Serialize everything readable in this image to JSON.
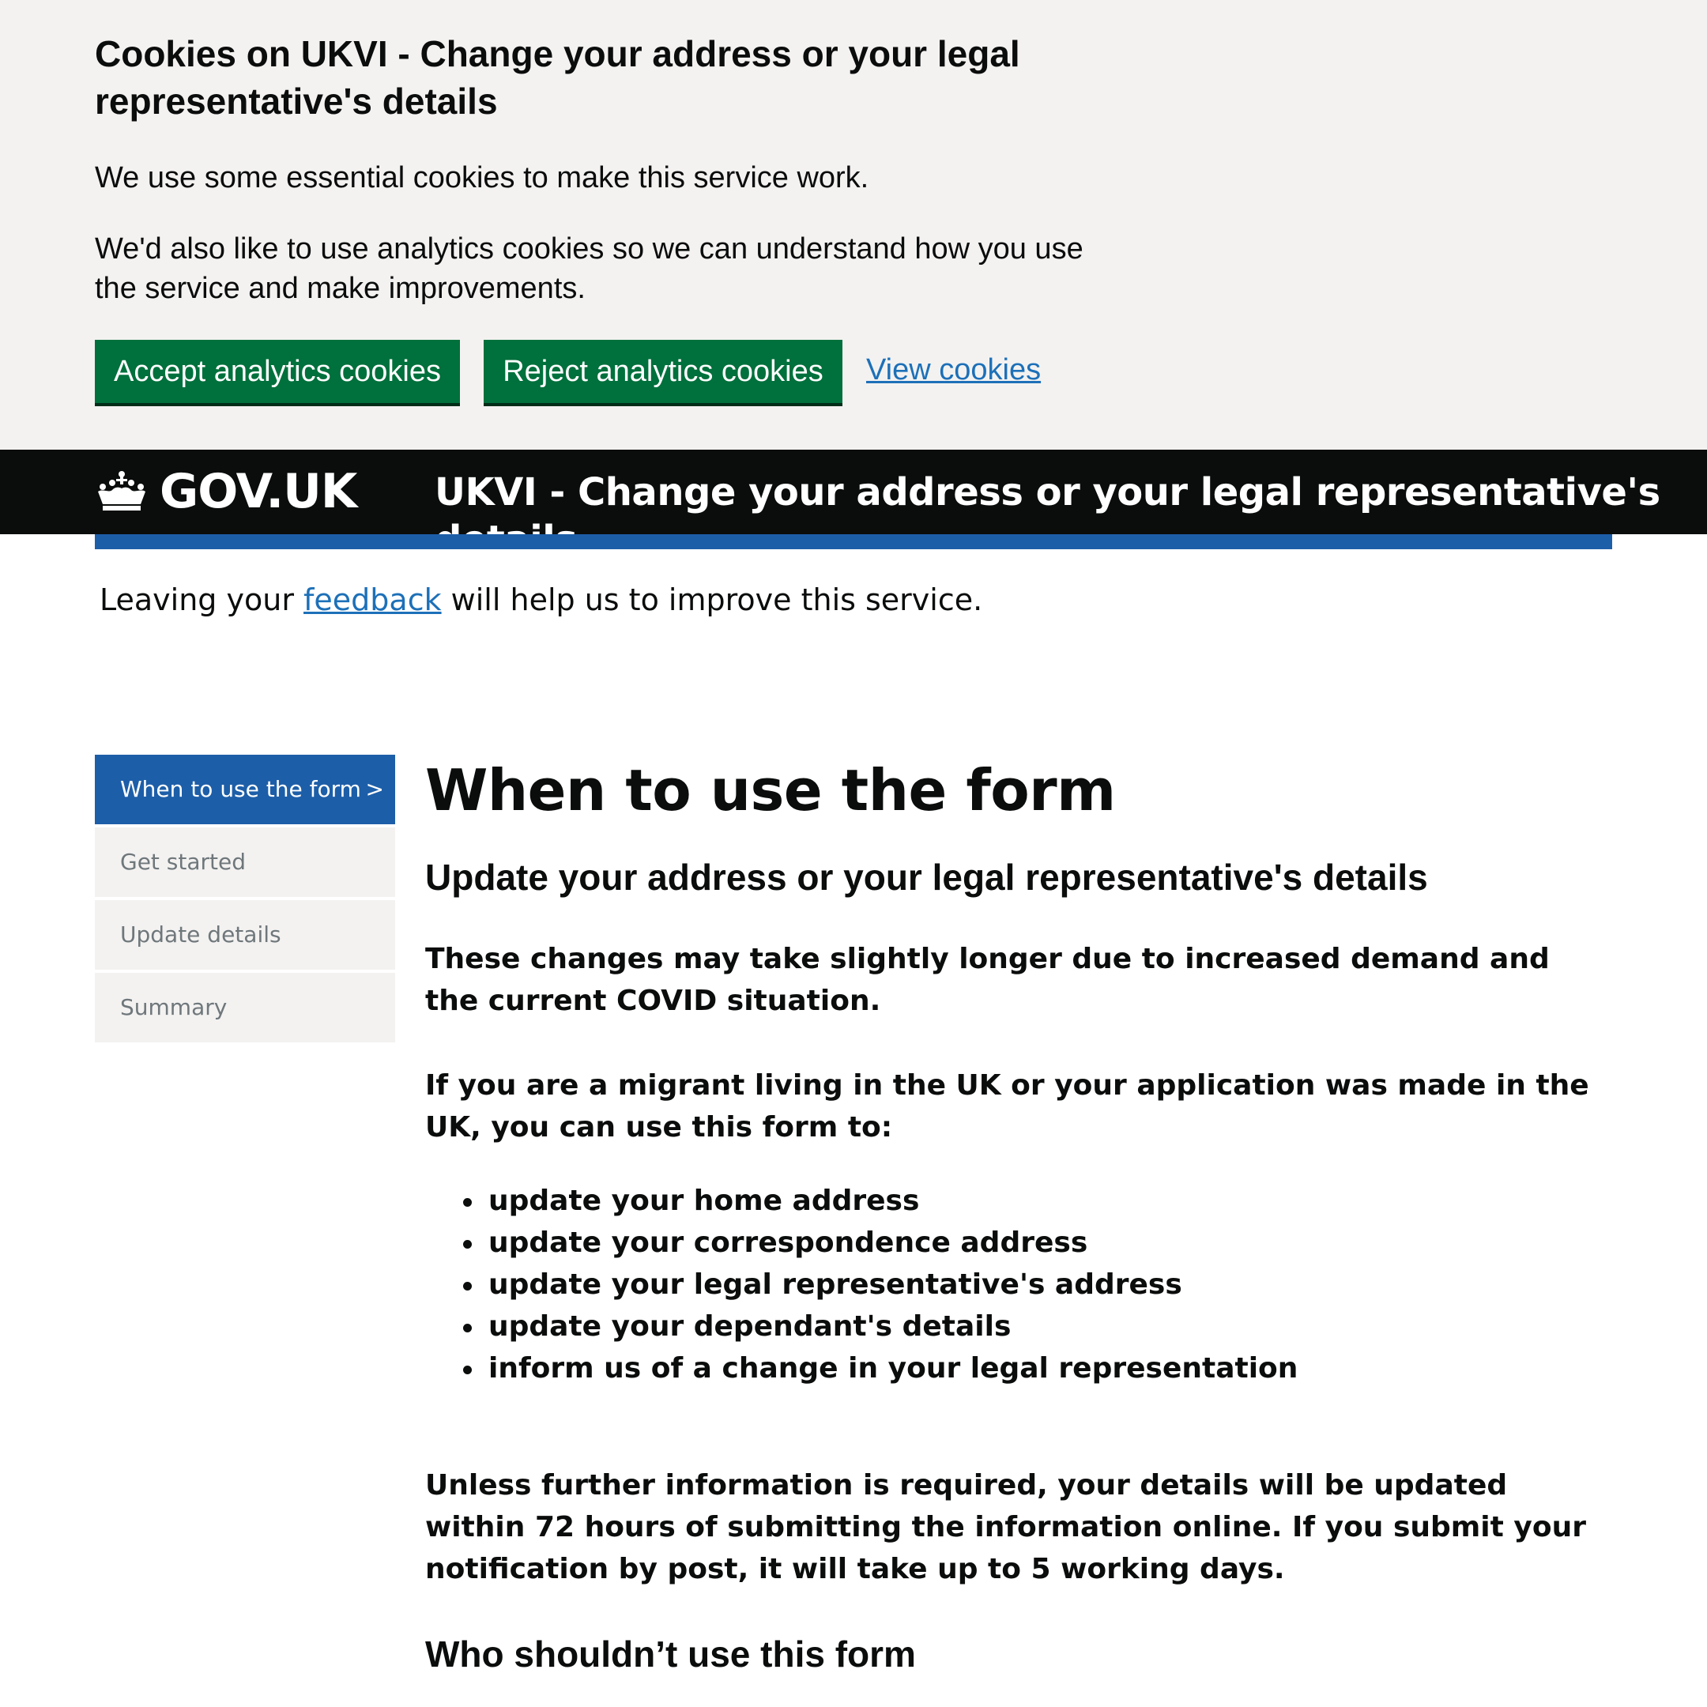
{
  "cookie_banner": {
    "title": "Cookies on UKVI - Change your address or your legal representative's details",
    "paragraph_1": "We use some essential cookies to make this service work.",
    "paragraph_2": "We'd also like to use analytics cookies so we can understand how you use the service and make improvements.",
    "accept_label": "Accept analytics cookies",
    "reject_label": "Reject analytics cookies",
    "view_link": "View cookies",
    "button_color": "#00703c"
  },
  "header": {
    "logo_text": "GOV.UK",
    "logo_icon": "crown-icon",
    "service_name": "UKVI - Change your address or your legal representative's details",
    "background": "#0b0c0c",
    "accent_bar": "#1d5ea8"
  },
  "feedback": {
    "before": "Leaving your ",
    "link": "feedback",
    "after": " will help us to improve this service."
  },
  "sidenav": {
    "items": [
      {
        "label": "When to use the form",
        "arrow": ">",
        "active": true
      },
      {
        "label": "Get started",
        "active": false
      },
      {
        "label": "Update details",
        "active": false
      },
      {
        "label": "Summary",
        "active": false
      }
    ]
  },
  "main": {
    "heading": "When to use the form",
    "subheading": "Update your address or your legal representative's details",
    "covid_notice": "These changes may take slightly longer due to increased demand and the current COVID situation.",
    "migrant_intro": "If you are a migrant living in the UK or your application was made in the UK, you can use this form to:",
    "uses": [
      "update your home address",
      "update your correspondence address",
      "update your legal representative's address",
      "update your dependant's details",
      "inform us of a change in your legal representation"
    ],
    "timing": "Unless further information is required, your details will be updated within 72 hours of submitting the information online. If you submit your notification by post, it will take up to 5 working days.",
    "who_heading": "Who shouldn’t use this form"
  }
}
